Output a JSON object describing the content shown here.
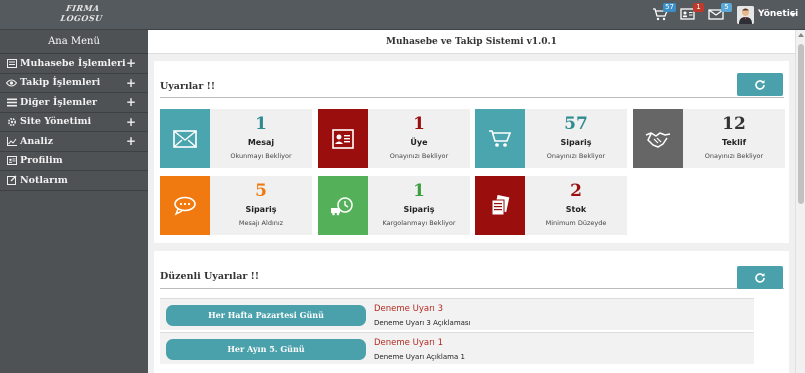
{
  "topbar": {
    "logo_line1": "FIRMA",
    "logo_line2": "LOGOSU",
    "cart_badge": "57",
    "id_badge": "1",
    "mail_badge": "5",
    "user_name": "Yönetici",
    "colors": {
      "cart_badge": "#3a8fc7",
      "id_badge": "#c0392b",
      "mail_badge": "#5aa8d8"
    }
  },
  "sidebar": {
    "title": "Ana Menü",
    "items": [
      {
        "label": "Muhasebe İşlemleri",
        "icon": "ledger-icon",
        "expandable": true
      },
      {
        "label": "Takip İşlemleri",
        "icon": "eye-icon",
        "expandable": true
      },
      {
        "label": "Diğer İşlemler",
        "icon": "list-icon",
        "expandable": true
      },
      {
        "label": "Site Yönetimi",
        "icon": "gear-icon",
        "expandable": true
      },
      {
        "label": "Analiz",
        "icon": "chart-icon",
        "expandable": true
      },
      {
        "label": "Profilim",
        "icon": "profile-icon",
        "expandable": false
      },
      {
        "label": "Notlarım",
        "icon": "note-icon",
        "expandable": false
      }
    ]
  },
  "main": {
    "header": "Muhasebe ve Takip Sistemi v1.0.1",
    "warnings": {
      "title": "Uyarılar !!",
      "cards": [
        {
          "number": "1",
          "label": "Mesaj",
          "sub": "Okunmayı Bekliyor",
          "icon": "envelope-icon",
          "icon_color": "#4ba5ae",
          "num_color": "#2e8b8f"
        },
        {
          "number": "1",
          "label": "Üye",
          "sub": "Onayınızı Bekliyor",
          "icon": "id-card-icon",
          "icon_color": "#9b0e0e",
          "num_color": "#9b0e0e"
        },
        {
          "number": "57",
          "label": "Sipariş",
          "sub": "Onayınızı Bekliyor",
          "icon": "cart-icon",
          "icon_color": "#4ba5ae",
          "num_color": "#2e8b8f"
        },
        {
          "number": "12",
          "label": "Teklif",
          "sub": "Onayınızı Bekliyor",
          "icon": "handshake-icon",
          "icon_color": "#666666",
          "num_color": "#333333"
        },
        {
          "number": "5",
          "label": "Sipariş",
          "sub": "Mesajı Aldınız",
          "icon": "chat-icon",
          "icon_color": "#f07a10",
          "num_color": "#f07a10"
        },
        {
          "number": "1",
          "label": "Sipariş",
          "sub": "Kargolanmayı Bekliyor",
          "icon": "delivery-icon",
          "icon_color": "#55b05a",
          "num_color": "#3da040"
        },
        {
          "number": "2",
          "label": "Stok",
          "sub": "Minimum Düzeyde",
          "icon": "documents-icon",
          "icon_color": "#9b0e0e",
          "num_color": "#9b0e0e"
        }
      ]
    },
    "regular": {
      "title": "Düzenli Uyarılar !!",
      "rows": [
        {
          "button": "Her Hafta Pazartesi Günü",
          "title": "Deneme Uyarı 3",
          "desc": "Deneme Uyarı 3 Açıklaması"
        },
        {
          "button": "Her Ayın 5. Günü",
          "title": "Deneme Uyarı 1",
          "desc": "Deneme Uyarı Açıklama 1"
        }
      ]
    }
  }
}
